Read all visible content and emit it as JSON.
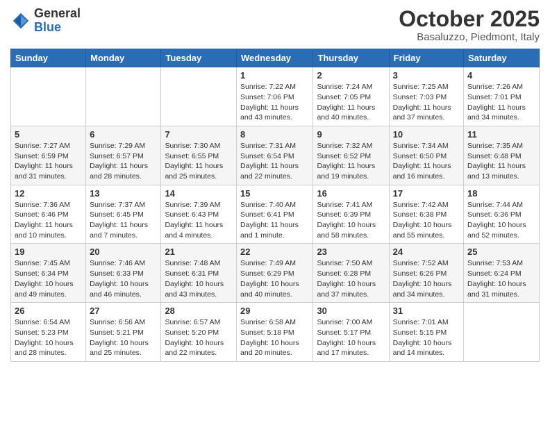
{
  "header": {
    "logo_general": "General",
    "logo_blue": "Blue",
    "month_title": "October 2025",
    "location": "Basaluzzo, Piedmont, Italy"
  },
  "weekdays": [
    "Sunday",
    "Monday",
    "Tuesday",
    "Wednesday",
    "Thursday",
    "Friday",
    "Saturday"
  ],
  "weeks": [
    [
      {
        "day": "",
        "info": ""
      },
      {
        "day": "",
        "info": ""
      },
      {
        "day": "",
        "info": ""
      },
      {
        "day": "1",
        "info": "Sunrise: 7:22 AM\nSunset: 7:06 PM\nDaylight: 11 hours\nand 43 minutes."
      },
      {
        "day": "2",
        "info": "Sunrise: 7:24 AM\nSunset: 7:05 PM\nDaylight: 11 hours\nand 40 minutes."
      },
      {
        "day": "3",
        "info": "Sunrise: 7:25 AM\nSunset: 7:03 PM\nDaylight: 11 hours\nand 37 minutes."
      },
      {
        "day": "4",
        "info": "Sunrise: 7:26 AM\nSunset: 7:01 PM\nDaylight: 11 hours\nand 34 minutes."
      }
    ],
    [
      {
        "day": "5",
        "info": "Sunrise: 7:27 AM\nSunset: 6:59 PM\nDaylight: 11 hours\nand 31 minutes."
      },
      {
        "day": "6",
        "info": "Sunrise: 7:29 AM\nSunset: 6:57 PM\nDaylight: 11 hours\nand 28 minutes."
      },
      {
        "day": "7",
        "info": "Sunrise: 7:30 AM\nSunset: 6:55 PM\nDaylight: 11 hours\nand 25 minutes."
      },
      {
        "day": "8",
        "info": "Sunrise: 7:31 AM\nSunset: 6:54 PM\nDaylight: 11 hours\nand 22 minutes."
      },
      {
        "day": "9",
        "info": "Sunrise: 7:32 AM\nSunset: 6:52 PM\nDaylight: 11 hours\nand 19 minutes."
      },
      {
        "day": "10",
        "info": "Sunrise: 7:34 AM\nSunset: 6:50 PM\nDaylight: 11 hours\nand 16 minutes."
      },
      {
        "day": "11",
        "info": "Sunrise: 7:35 AM\nSunset: 6:48 PM\nDaylight: 11 hours\nand 13 minutes."
      }
    ],
    [
      {
        "day": "12",
        "info": "Sunrise: 7:36 AM\nSunset: 6:46 PM\nDaylight: 11 hours\nand 10 minutes."
      },
      {
        "day": "13",
        "info": "Sunrise: 7:37 AM\nSunset: 6:45 PM\nDaylight: 11 hours\nand 7 minutes."
      },
      {
        "day": "14",
        "info": "Sunrise: 7:39 AM\nSunset: 6:43 PM\nDaylight: 11 hours\nand 4 minutes."
      },
      {
        "day": "15",
        "info": "Sunrise: 7:40 AM\nSunset: 6:41 PM\nDaylight: 11 hours\nand 1 minute."
      },
      {
        "day": "16",
        "info": "Sunrise: 7:41 AM\nSunset: 6:39 PM\nDaylight: 10 hours\nand 58 minutes."
      },
      {
        "day": "17",
        "info": "Sunrise: 7:42 AM\nSunset: 6:38 PM\nDaylight: 10 hours\nand 55 minutes."
      },
      {
        "day": "18",
        "info": "Sunrise: 7:44 AM\nSunset: 6:36 PM\nDaylight: 10 hours\nand 52 minutes."
      }
    ],
    [
      {
        "day": "19",
        "info": "Sunrise: 7:45 AM\nSunset: 6:34 PM\nDaylight: 10 hours\nand 49 minutes."
      },
      {
        "day": "20",
        "info": "Sunrise: 7:46 AM\nSunset: 6:33 PM\nDaylight: 10 hours\nand 46 minutes."
      },
      {
        "day": "21",
        "info": "Sunrise: 7:48 AM\nSunset: 6:31 PM\nDaylight: 10 hours\nand 43 minutes."
      },
      {
        "day": "22",
        "info": "Sunrise: 7:49 AM\nSunset: 6:29 PM\nDaylight: 10 hours\nand 40 minutes."
      },
      {
        "day": "23",
        "info": "Sunrise: 7:50 AM\nSunset: 6:28 PM\nDaylight: 10 hours\nand 37 minutes."
      },
      {
        "day": "24",
        "info": "Sunrise: 7:52 AM\nSunset: 6:26 PM\nDaylight: 10 hours\nand 34 minutes."
      },
      {
        "day": "25",
        "info": "Sunrise: 7:53 AM\nSunset: 6:24 PM\nDaylight: 10 hours\nand 31 minutes."
      }
    ],
    [
      {
        "day": "26",
        "info": "Sunrise: 6:54 AM\nSunset: 5:23 PM\nDaylight: 10 hours\nand 28 minutes."
      },
      {
        "day": "27",
        "info": "Sunrise: 6:56 AM\nSunset: 5:21 PM\nDaylight: 10 hours\nand 25 minutes."
      },
      {
        "day": "28",
        "info": "Sunrise: 6:57 AM\nSunset: 5:20 PM\nDaylight: 10 hours\nand 22 minutes."
      },
      {
        "day": "29",
        "info": "Sunrise: 6:58 AM\nSunset: 5:18 PM\nDaylight: 10 hours\nand 20 minutes."
      },
      {
        "day": "30",
        "info": "Sunrise: 7:00 AM\nSunset: 5:17 PM\nDaylight: 10 hours\nand 17 minutes."
      },
      {
        "day": "31",
        "info": "Sunrise: 7:01 AM\nSunset: 5:15 PM\nDaylight: 10 hours\nand 14 minutes."
      },
      {
        "day": "",
        "info": ""
      }
    ]
  ]
}
